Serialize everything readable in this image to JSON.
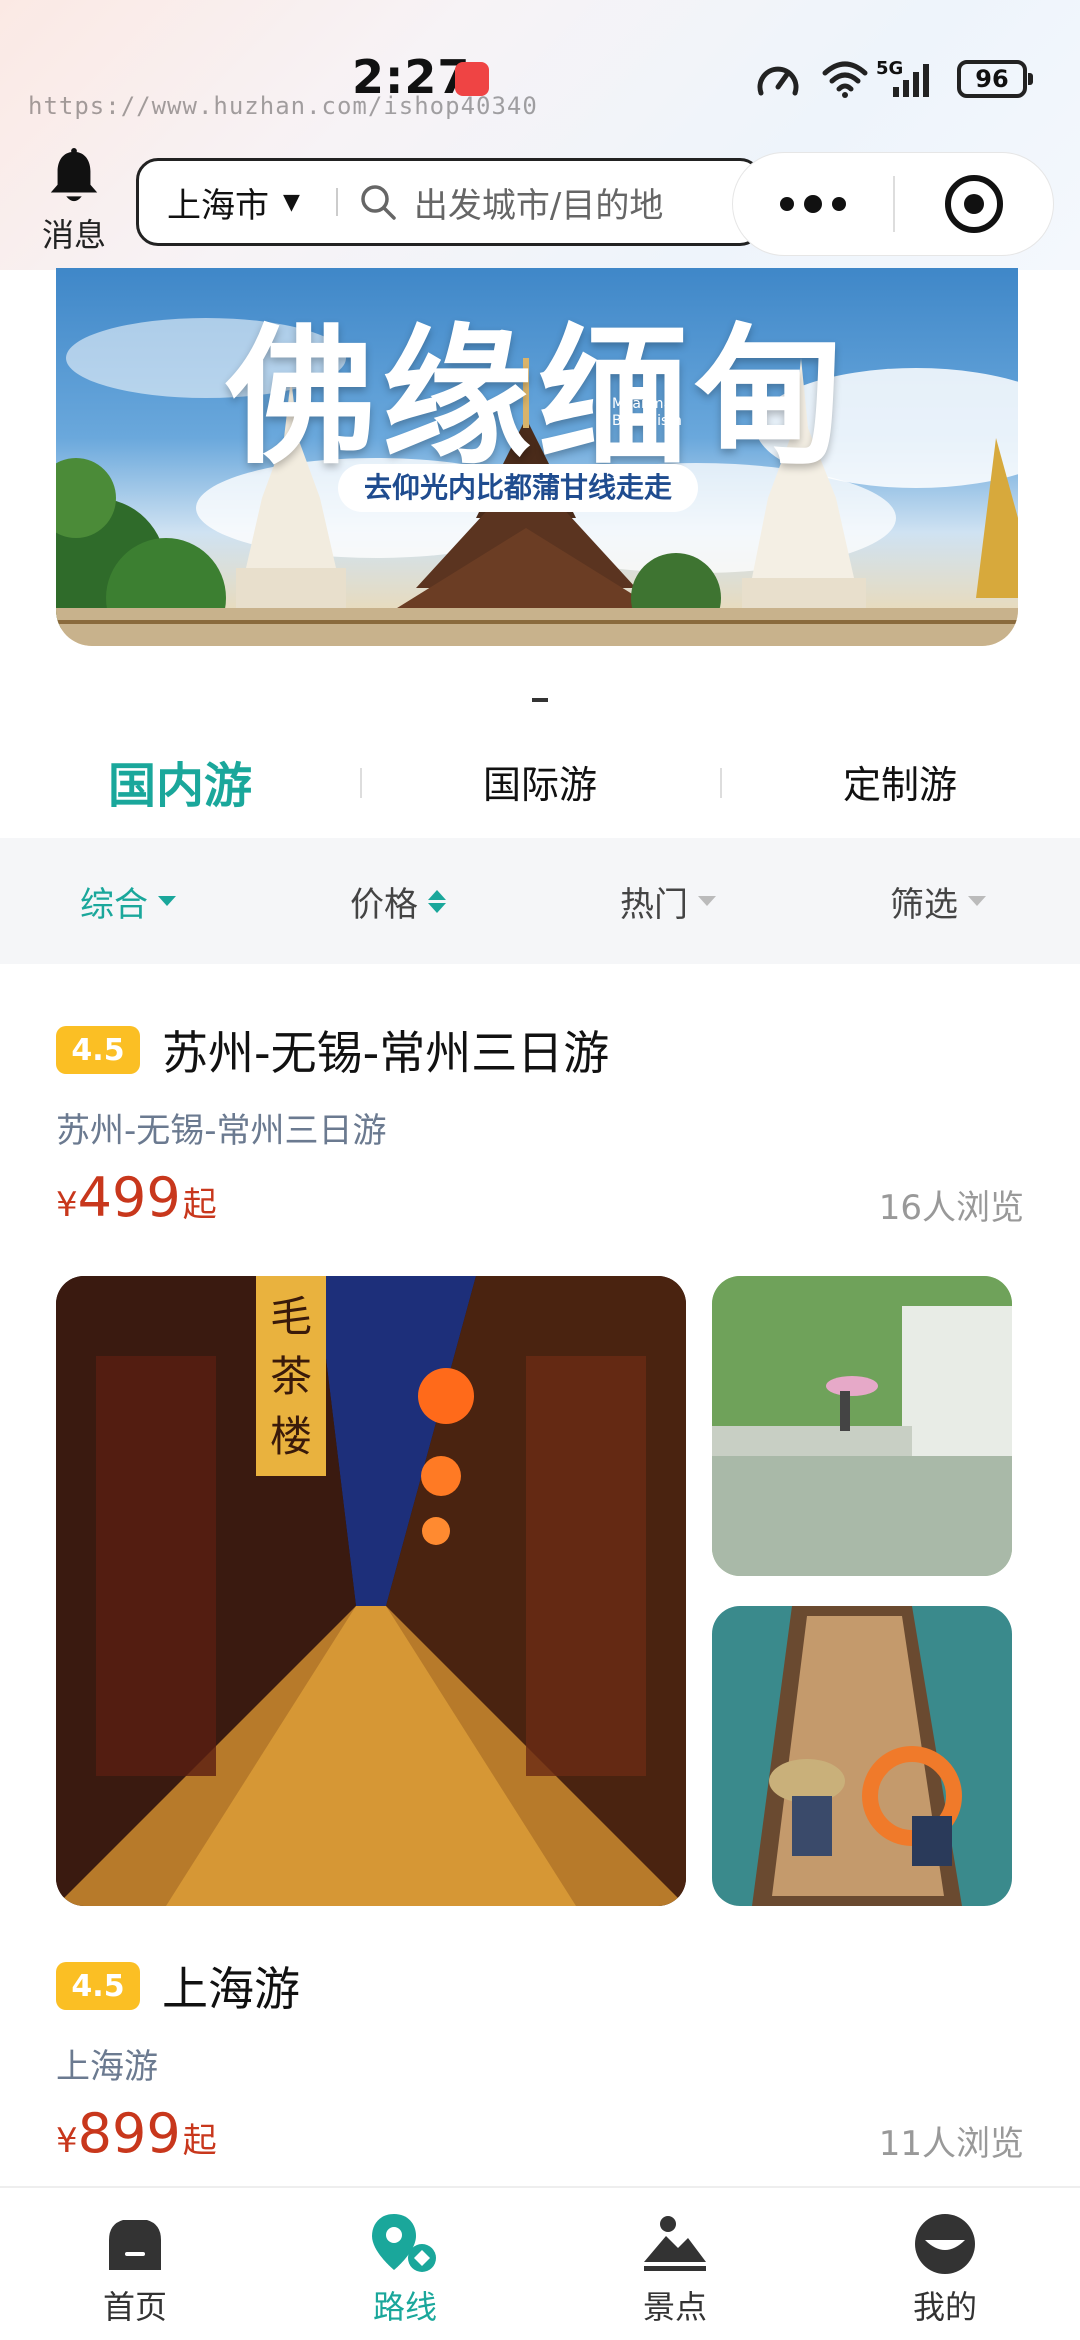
{
  "status_bar": {
    "time": "2:27",
    "watermark": "https://www.huzhan.com/ishop40340",
    "network": "5G",
    "battery": "96"
  },
  "header": {
    "message_label": "消息",
    "city": "上海市",
    "search_placeholder": "出发城市/目的地"
  },
  "banner": {
    "title": "佛缘缅甸",
    "subtitle_en_1": "Myanmar",
    "subtitle_en_2": "Buddhism",
    "tagline": "去仰光内比都蒲甘线走走"
  },
  "category_tabs": [
    {
      "label": "国内游",
      "active": true
    },
    {
      "label": "国际游",
      "active": false
    },
    {
      "label": "定制游",
      "active": false
    }
  ],
  "sort_bar": [
    {
      "label": "综合",
      "active": true
    },
    {
      "label": "价格",
      "active": false
    },
    {
      "label": "热门",
      "active": false
    },
    {
      "label": "筛选",
      "active": false
    }
  ],
  "routes": [
    {
      "rating": "4.5",
      "title": "苏州-无锡-常州三日游",
      "subtitle": "苏州-无锡-常州三日游",
      "currency": "¥",
      "price": "499",
      "price_suffix": "起",
      "views": "16人浏览"
    },
    {
      "rating": "4.5",
      "title": "上海游",
      "subtitle": "上海游",
      "currency": "¥",
      "price": "899",
      "price_suffix": "起",
      "views": "11人浏览"
    }
  ],
  "bottom_nav": [
    {
      "label": "首页",
      "icon": "home-icon",
      "active": false
    },
    {
      "label": "路线",
      "icon": "route-pin-icon",
      "active": true
    },
    {
      "label": "景点",
      "icon": "mountain-icon",
      "active": false
    },
    {
      "label": "我的",
      "icon": "profile-icon",
      "active": false
    }
  ],
  "colors": {
    "accent": "#1aa79b",
    "price": "#c8371c",
    "rating_badge": "#fbbf24"
  }
}
